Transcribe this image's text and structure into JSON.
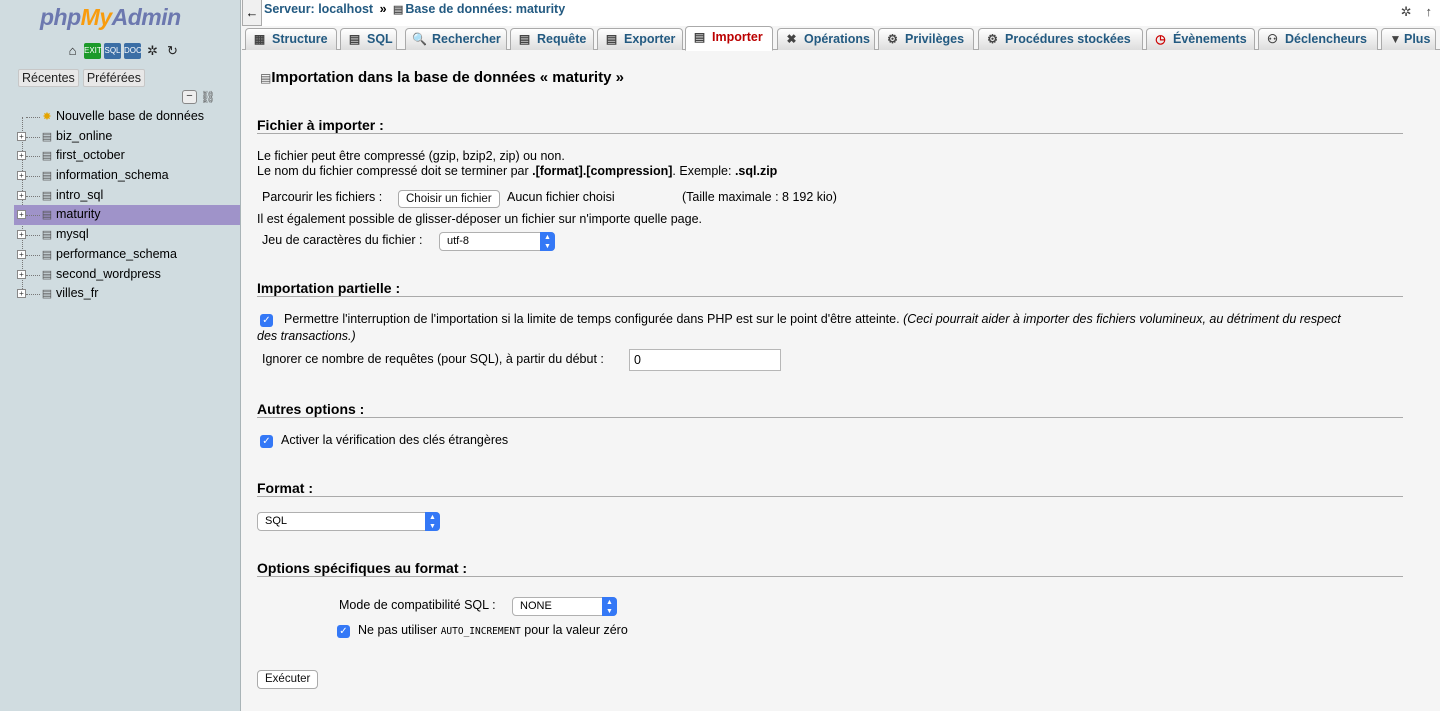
{
  "logo": {
    "part1": "php",
    "part2": "My",
    "part3": "Admin"
  },
  "nav_tabs": {
    "recent": "Récentes",
    "favorites": "Préférées"
  },
  "nav_icons": {
    "home": "⌂",
    "exit": "EXIT",
    "query": "SQL",
    "docs": "DOC",
    "settings": "✲",
    "reload": "↻"
  },
  "tree": {
    "new_db": "Nouvelle base de données",
    "items": [
      "biz_online",
      "first_october",
      "information_schema",
      "intro_sql",
      "maturity",
      "mysql",
      "performance_schema",
      "second_wordpress",
      "villes_fr"
    ],
    "selected": "maturity"
  },
  "breadcrumb": {
    "server": "Serveur: localhost",
    "separator": "»",
    "database": "Base de données: maturity"
  },
  "tabs": [
    {
      "label": "Structure",
      "icon": "structure-icon"
    },
    {
      "label": "SQL",
      "icon": "sql-icon"
    },
    {
      "label": "Rechercher",
      "icon": "search-icon"
    },
    {
      "label": "Requête",
      "icon": "query-icon"
    },
    {
      "label": "Exporter",
      "icon": "export-icon"
    },
    {
      "label": "Importer",
      "icon": "import-icon"
    },
    {
      "label": "Opérations",
      "icon": "tools-icon"
    },
    {
      "label": "Privilèges",
      "icon": "privileges-icon"
    },
    {
      "label": "Procédures stockées",
      "icon": "routines-icon"
    },
    {
      "label": "Évènements",
      "icon": "events-icon"
    },
    {
      "label": "Déclencheurs",
      "icon": "triggers-icon"
    },
    {
      "label": "Plus",
      "icon": "chevron-down-icon"
    }
  ],
  "page": {
    "title": "Importation dans la base de données « maturity »",
    "file_section": {
      "heading": "Fichier à importer :",
      "line1": "Le fichier peut être compressé (gzip, bzip2, zip) ou non.",
      "line2_prefix": "Le nom du fichier compressé doit se terminer par ",
      "line2_format": ".[format].[compression]",
      "line2_mid": ". Exemple: ",
      "line2_example": ".sql.zip",
      "browse_label": "Parcourir les fichiers :",
      "choose_button": "Choisir un fichier",
      "no_file": "Aucun fichier choisi",
      "max_size": "(Taille maximale : 8 192 kio)",
      "drag_drop": "Il est également possible de glisser-déposer un fichier sur n'importe quelle page.",
      "charset_label": "Jeu de caractères du fichier :",
      "charset_value": "utf-8"
    },
    "partial_section": {
      "heading": "Importation partielle :",
      "interrupt_text": "Permettre l'interruption de l'importation si la limite de temps configurée dans PHP est sur le point d'être atteinte.",
      "interrupt_note_1": "(Ceci pourrait aider à importer des fichiers volumineux, au détriment du respect",
      "interrupt_note_2": "des transactions.)",
      "skip_label": "Ignorer ce nombre de requêtes (pour SQL), à partir du début :",
      "skip_value": "0"
    },
    "other_section": {
      "heading": "Autres options :",
      "fk_label": "Activer la vérification des clés étrangères"
    },
    "format_section": {
      "heading": "Format :",
      "format_value": "SQL"
    },
    "format_options": {
      "heading": "Options spécifiques au format :",
      "compat_label": "Mode de compatibilité SQL :",
      "compat_value": "NONE",
      "autoinc_prefix": "Ne pas utiliser",
      "autoinc_code": "AUTO_INCREMENT",
      "autoinc_suffix": "pour la valeur zéro"
    },
    "execute_button": "Exécuter"
  }
}
